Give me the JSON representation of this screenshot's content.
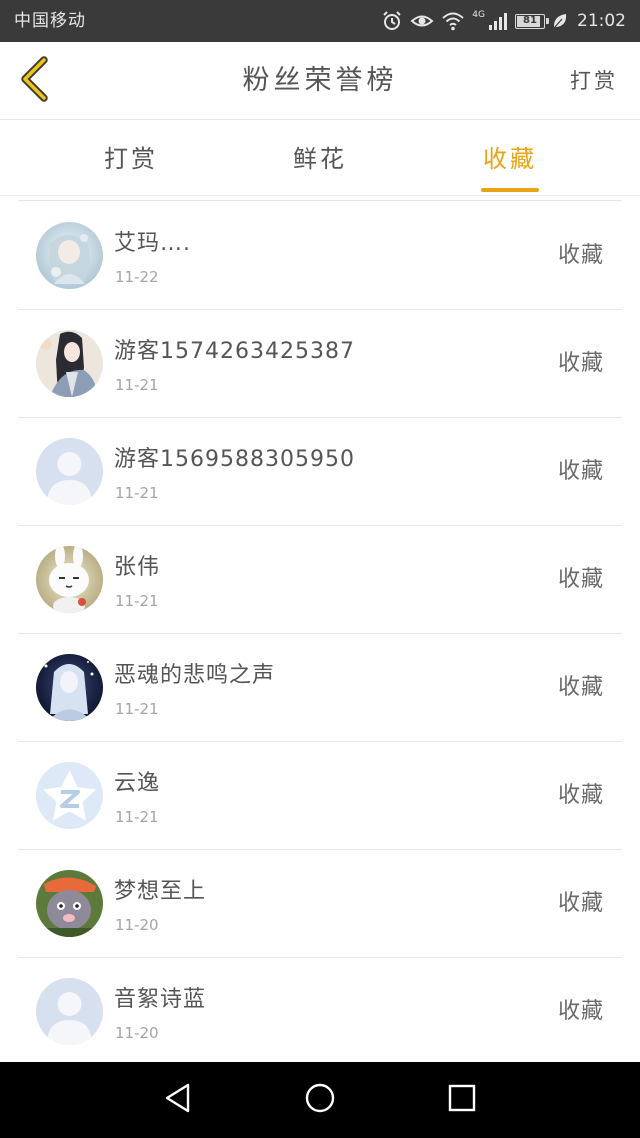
{
  "status_bar": {
    "carrier": "中国移动",
    "network": "4G",
    "battery": "81",
    "time": "21:02",
    "icons": [
      "alarm-icon",
      "eye-icon",
      "wifi-icon",
      "signal-icon",
      "battery-icon",
      "leaf-icon"
    ]
  },
  "header": {
    "back_icon": "chevron-left-icon",
    "title": "粉丝荣誉榜",
    "reward_label": "打赏"
  },
  "tabs": [
    {
      "label": "打赏",
      "active": false
    },
    {
      "label": "鲜花",
      "active": false
    },
    {
      "label": "收藏",
      "active": true
    }
  ],
  "list": {
    "items": [
      {
        "name": "艾玛….",
        "date": "11-22",
        "action": "收藏",
        "avatar": "avatar-anime-girl-blue"
      },
      {
        "name": "游客1574263425387",
        "date": "11-21",
        "action": "收藏",
        "avatar": "avatar-anime-man"
      },
      {
        "name": "游客1569588305950",
        "date": "11-21",
        "action": "收藏",
        "avatar": "avatar-default"
      },
      {
        "name": "张伟",
        "date": "11-21",
        "action": "收藏",
        "avatar": "avatar-bunny"
      },
      {
        "name": "恶魂的悲鸣之声",
        "date": "11-21",
        "action": "收藏",
        "avatar": "avatar-dark-girl"
      },
      {
        "name": "云逸",
        "date": "11-21",
        "action": "收藏",
        "avatar": "avatar-qq-star"
      },
      {
        "name": "梦想至上",
        "date": "11-20",
        "action": "收藏",
        "avatar": "avatar-cartoon-cat"
      },
      {
        "name": "音絮诗蓝",
        "date": "11-20",
        "action": "收藏",
        "avatar": "avatar-default"
      }
    ]
  },
  "nav_bar": {
    "icons": [
      "back-triangle-icon",
      "home-circle-icon",
      "recent-square-icon"
    ]
  },
  "colors": {
    "accent": "#e8a317",
    "text": "#555555",
    "date": "#a5a5a5",
    "status_bar": "#3a3a3a",
    "nav_bar": "#000000"
  }
}
